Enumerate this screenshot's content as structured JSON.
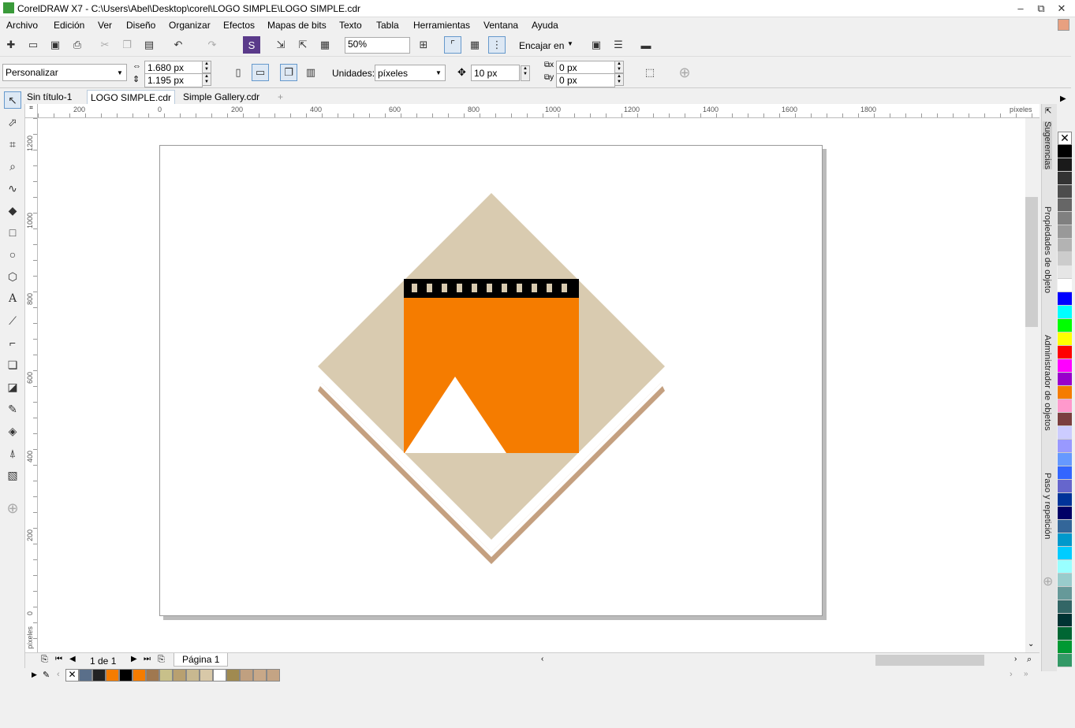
{
  "window": {
    "title": "CorelDRAW X7 - C:\\Users\\Abel\\Desktop\\corel\\LOGO SIMPLE\\LOGO SIMPLE.cdr",
    "minimize": "–",
    "maximize": "⧉",
    "close": "✕"
  },
  "menu": [
    "Archivo",
    "Edición",
    "Ver",
    "Diseño",
    "Organizar",
    "Efectos",
    "Mapas de bits",
    "Texto",
    "Tabla",
    "Herramientas",
    "Ventana",
    "Ayuda"
  ],
  "toolbar": {
    "zoom": "50%",
    "snap": "Encajar en"
  },
  "propbar": {
    "preset": "Personalizar",
    "width": "1.680 px",
    "height": "1.195 px",
    "units_label": "Unidades:",
    "units": "píxeles",
    "nudge": "10 px",
    "dup_x": "0 px",
    "dup_y": "0 px"
  },
  "tabs": [
    "Sin título-1",
    "LOGO SIMPLE.cdr",
    "Simple Gallery.cdr"
  ],
  "hruler_ticks": [
    "200",
    "0",
    "200",
    "400",
    "600",
    "800",
    "1000",
    "1200",
    "1400",
    "1600",
    "1800"
  ],
  "hruler_unit": "píxeles",
  "vruler_ticks": [
    "1200",
    "1000",
    "800",
    "600",
    "400",
    "200",
    "0"
  ],
  "vruler_unit": "píxeles",
  "dock_tabs": [
    "Sugerencias",
    "Propiedades de objeto",
    "Administrador de objetos",
    "Paso y repetición"
  ],
  "status": {
    "page_count": "1 de 1",
    "page_tab": "Página 1"
  },
  "palette_colors": [
    "#000000",
    "#1a1a1a",
    "#333333",
    "#4d4d4d",
    "#666666",
    "#808080",
    "#999999",
    "#b3b3b3",
    "#cccccc",
    "#e6e6e6",
    "#ffffff",
    "#0000ff",
    "#00ffff",
    "#00ff00",
    "#ffff00",
    "#ff0000",
    "#ff00ff",
    "#9900cc",
    "#f57c00",
    "#ff99cc",
    "#7b3f3f",
    "#ccccff",
    "#9999ff",
    "#6699ff",
    "#3366ff",
    "#6666cc",
    "#003399",
    "#000066",
    "#336699",
    "#0099cc",
    "#00ccff",
    "#99ffff",
    "#99cccc",
    "#669999",
    "#336666",
    "#003333",
    "#006633",
    "#009933",
    "#339966"
  ],
  "doc_palette": [
    "#5a6f8a",
    "#222222",
    "#f57c00",
    "#000000",
    "#f57c00",
    "#a07850",
    "#c8c08a",
    "#b8a070",
    "#c8b890",
    "#d8c8a8",
    "#ffffff",
    "#a08a50",
    "#c0a080",
    "#c8a888",
    "#c4a484"
  ]
}
